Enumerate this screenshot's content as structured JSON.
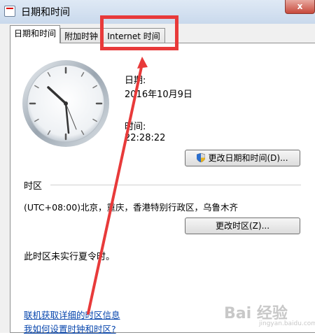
{
  "window": {
    "title": "日期和时间",
    "close_label": "x"
  },
  "tabs": [
    {
      "label": "日期和时间"
    },
    {
      "label": "附加时钟"
    },
    {
      "label": "Internet 时间"
    }
  ],
  "datetime": {
    "date_label": "日期:",
    "date_value": "2016年10月9日",
    "time_label": "时间:",
    "time_value": "22:28:22",
    "change_button": "更改日期和时间(D)..."
  },
  "timezone": {
    "section_label": "时区",
    "value": "(UTC+08:00)北京，重庆，香港特别行政区，乌鲁木齐",
    "change_button": "更改时区(Z)...",
    "dst_note": "此时区未实行夏令时。"
  },
  "links": {
    "tz_info": "联机获取详细的时区信息",
    "how_to": "我如何设置时钟和时区?"
  },
  "watermark": {
    "text": "Bai 经验",
    "sub": "jingyan.baidu.com"
  },
  "colors": {
    "annotation": "#e83a3a",
    "link": "#0645ad"
  }
}
